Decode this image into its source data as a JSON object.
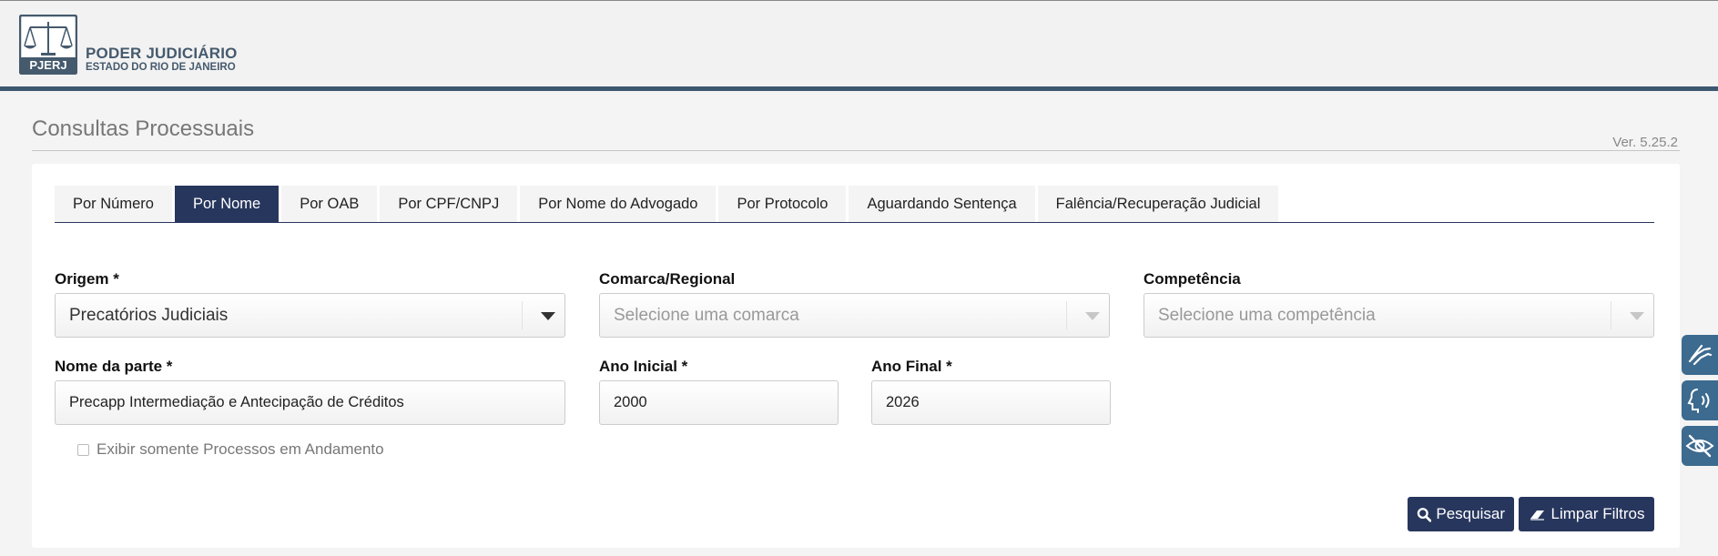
{
  "header": {
    "logo_text": "PJERJ",
    "brand_title": "PODER JUDICIÁRIO",
    "brand_subtitle": "ESTADO DO RIO DE JANEIRO"
  },
  "page": {
    "title": "Consultas Processuais",
    "version": "Ver. 5.25.2"
  },
  "tabs": [
    {
      "label": "Por Número",
      "active": false
    },
    {
      "label": "Por Nome",
      "active": true
    },
    {
      "label": "Por OAB",
      "active": false
    },
    {
      "label": "Por CPF/CNPJ",
      "active": false
    },
    {
      "label": "Por Nome do Advogado",
      "active": false
    },
    {
      "label": "Por Protocolo",
      "active": false
    },
    {
      "label": "Aguardando Sentença",
      "active": false
    },
    {
      "label": "Falência/Recuperação Judicial",
      "active": false
    }
  ],
  "form": {
    "origem": {
      "label": "Origem *",
      "value": "Precatórios Judiciais"
    },
    "comarca": {
      "label": "Comarca/Regional",
      "placeholder": "Selecione uma comarca"
    },
    "competencia": {
      "label": "Competência",
      "placeholder": "Selecione uma competência"
    },
    "nome_parte": {
      "label": "Nome da parte *",
      "value": "Precapp Intermediação e Antecipação de Créditos"
    },
    "ano_inicial": {
      "label": "Ano Inicial *",
      "value": "2000"
    },
    "ano_final": {
      "label": "Ano Final *",
      "value": "2026"
    },
    "andamento_checkbox": {
      "label": "Exibir somente Processos em Andamento",
      "checked": false
    }
  },
  "actions": {
    "search_label": "Pesquisar",
    "clear_label": "Limpar Filtros"
  },
  "accessibility": {
    "items": [
      "sign-language-icon",
      "audio-reader-icon",
      "low-vision-icon"
    ]
  },
  "colors": {
    "primary": "#27365d",
    "header_bar": "#3c5770",
    "accessibility": "#3d6a8f"
  }
}
